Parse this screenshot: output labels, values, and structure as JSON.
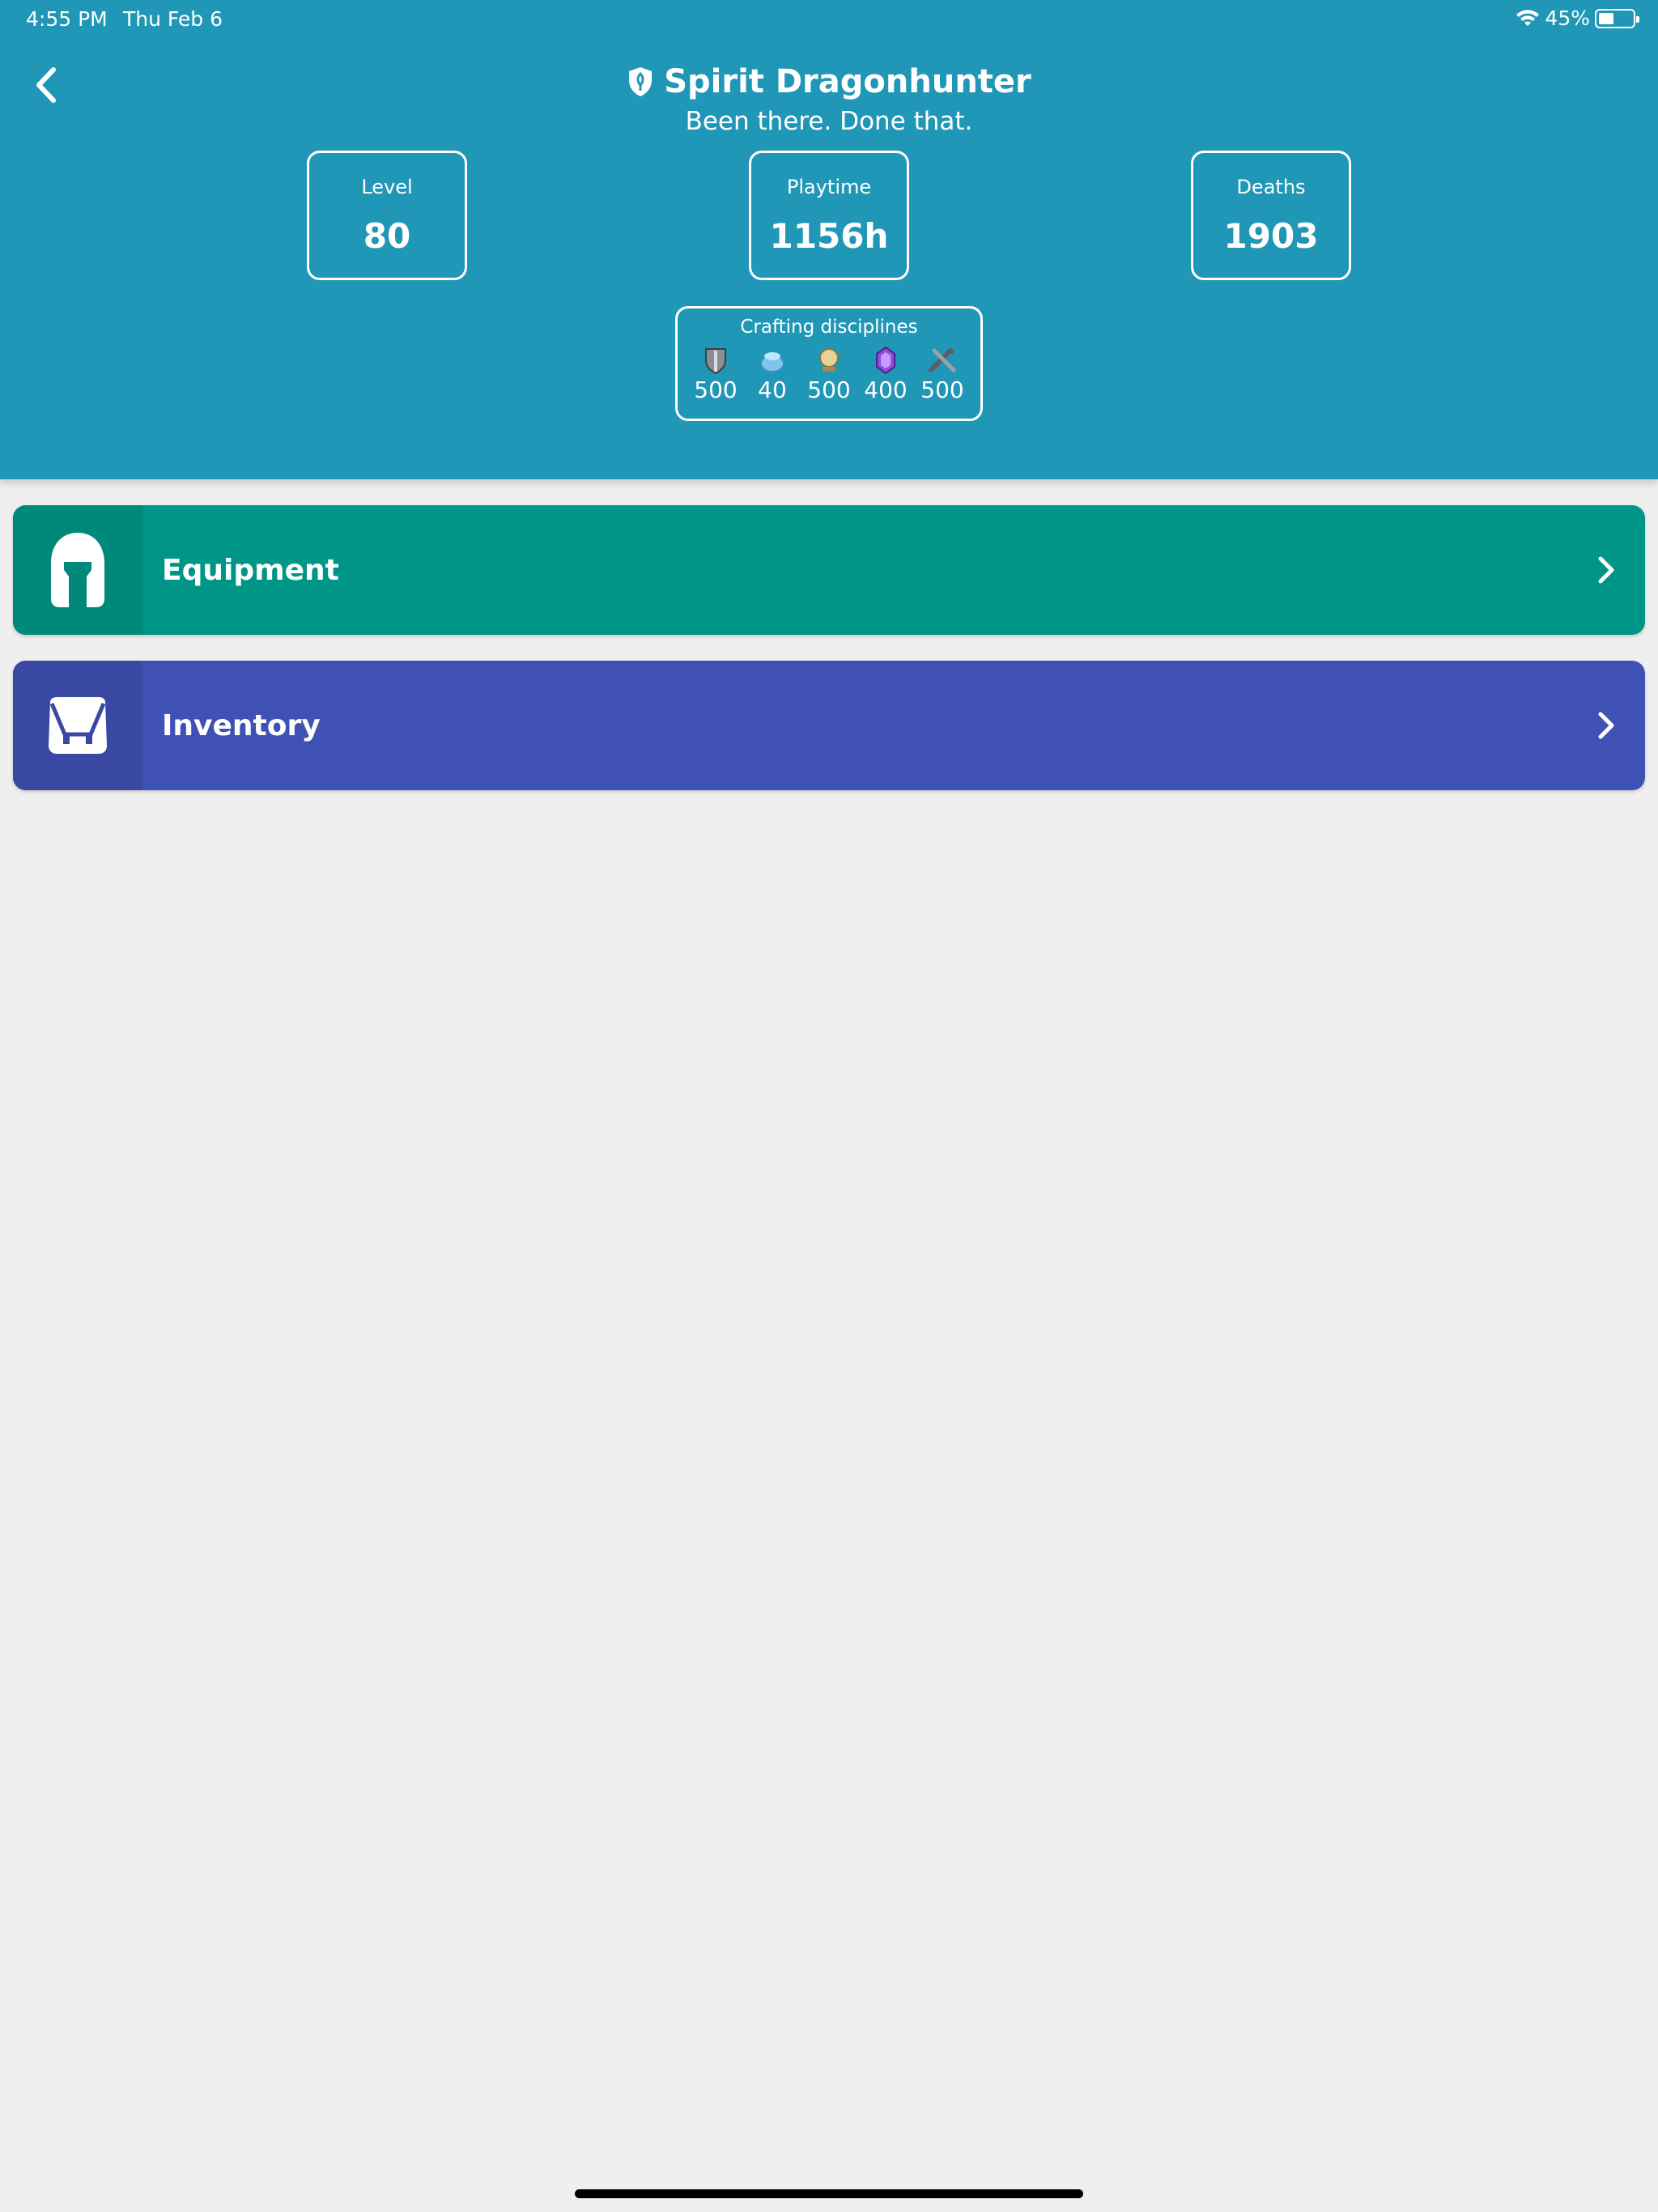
{
  "status_bar": {
    "time": "4:55 PM",
    "date": "Thu Feb 6",
    "battery": "45%",
    "battery_level": 0.45
  },
  "header": {
    "title": "Spirit Dragonhunter",
    "subtitle": "Been there. Done that.",
    "title_icon": "guardian-shield-icon",
    "background_color": "#2097b7"
  },
  "stats": {
    "level": {
      "label": "Level",
      "value": "80"
    },
    "playtime": {
      "label": "Playtime",
      "value": "1156h"
    },
    "deaths": {
      "label": "Deaths",
      "value": "1903"
    }
  },
  "crafting": {
    "label": "Crafting disciplines",
    "items": [
      {
        "icon": "armorsmith-icon",
        "value": "500"
      },
      {
        "icon": "chef-icon",
        "value": "40"
      },
      {
        "icon": "scribe-icon",
        "value": "500"
      },
      {
        "icon": "jeweler-icon",
        "value": "400"
      },
      {
        "icon": "weaponsmith-icon",
        "value": "500"
      }
    ]
  },
  "cards": [
    {
      "label": "Equipment",
      "icon": "helmet-icon",
      "color": "#009687",
      "icon_bg": "#00897b"
    },
    {
      "label": "Inventory",
      "icon": "bag-icon",
      "color": "#3f51b5",
      "icon_bg": "#3949a3"
    }
  ]
}
